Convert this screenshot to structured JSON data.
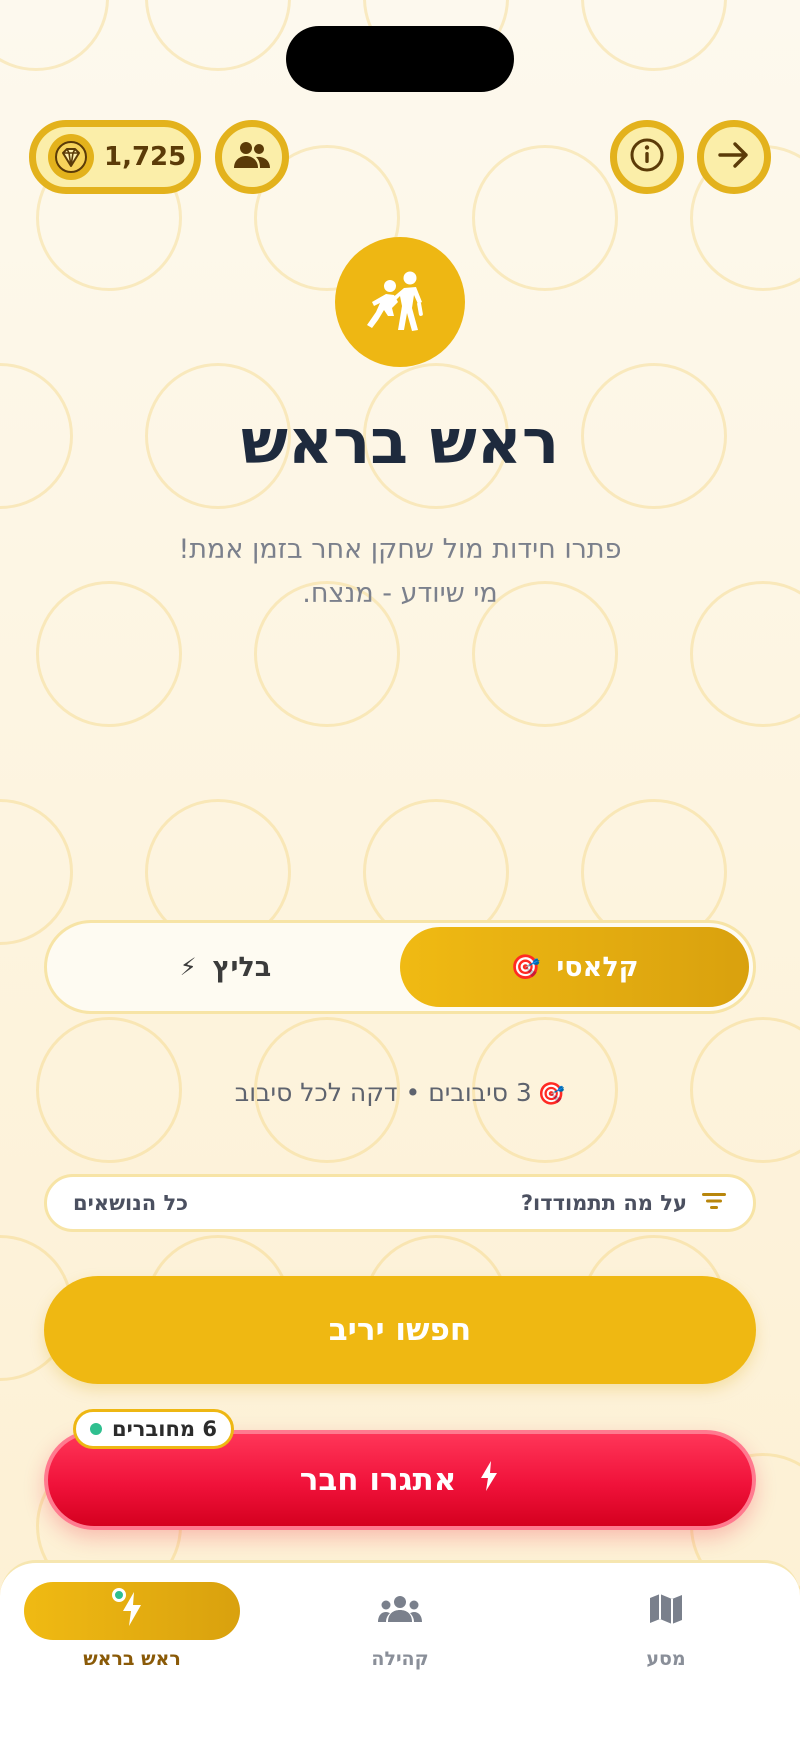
{
  "header": {
    "gems_count": "1,725",
    "gems_icon": "gem-icon",
    "friends_icon": "friends-icon",
    "info_icon": "info-icon",
    "back_icon": "arrow-right-icon"
  },
  "hero": {
    "icon": "players-duel-icon",
    "title": "ראש בראש",
    "subtitle_line1": "פתרו חידות מול שחקן אחר בזמן אמת!",
    "subtitle_line2": "מי שיודע - מנצח."
  },
  "mode_selector": {
    "options": [
      {
        "label": "קלאסי",
        "emoji": "🎯",
        "selected": true
      },
      {
        "label": "בליץ",
        "emoji": "⚡",
        "selected": false
      }
    ]
  },
  "rounds_info": {
    "emoji": "🎯",
    "text": "3 סיבובים • דקה לכל סיבוב"
  },
  "topic": {
    "question": "על מה תתמודדו?",
    "value": "כל הנושאים",
    "icon": "filter-icon"
  },
  "actions": {
    "find_opponent": "חפשו יריב",
    "challenge_friend": "אתגרו חבר",
    "online_count": "6 מחוברים"
  },
  "bottom_nav": {
    "items": [
      {
        "label": "ראש בראש",
        "icon": "bolt-icon",
        "active": true
      },
      {
        "label": "קהילה",
        "icon": "community-icon",
        "active": false
      },
      {
        "label": "מסע",
        "icon": "map-icon",
        "active": false
      }
    ]
  },
  "colors": {
    "accent": "#EEB713",
    "accent_border": "#E3B21C",
    "danger": "#F0123A",
    "online": "#2FBF8F",
    "title": "#1E2A3D"
  }
}
